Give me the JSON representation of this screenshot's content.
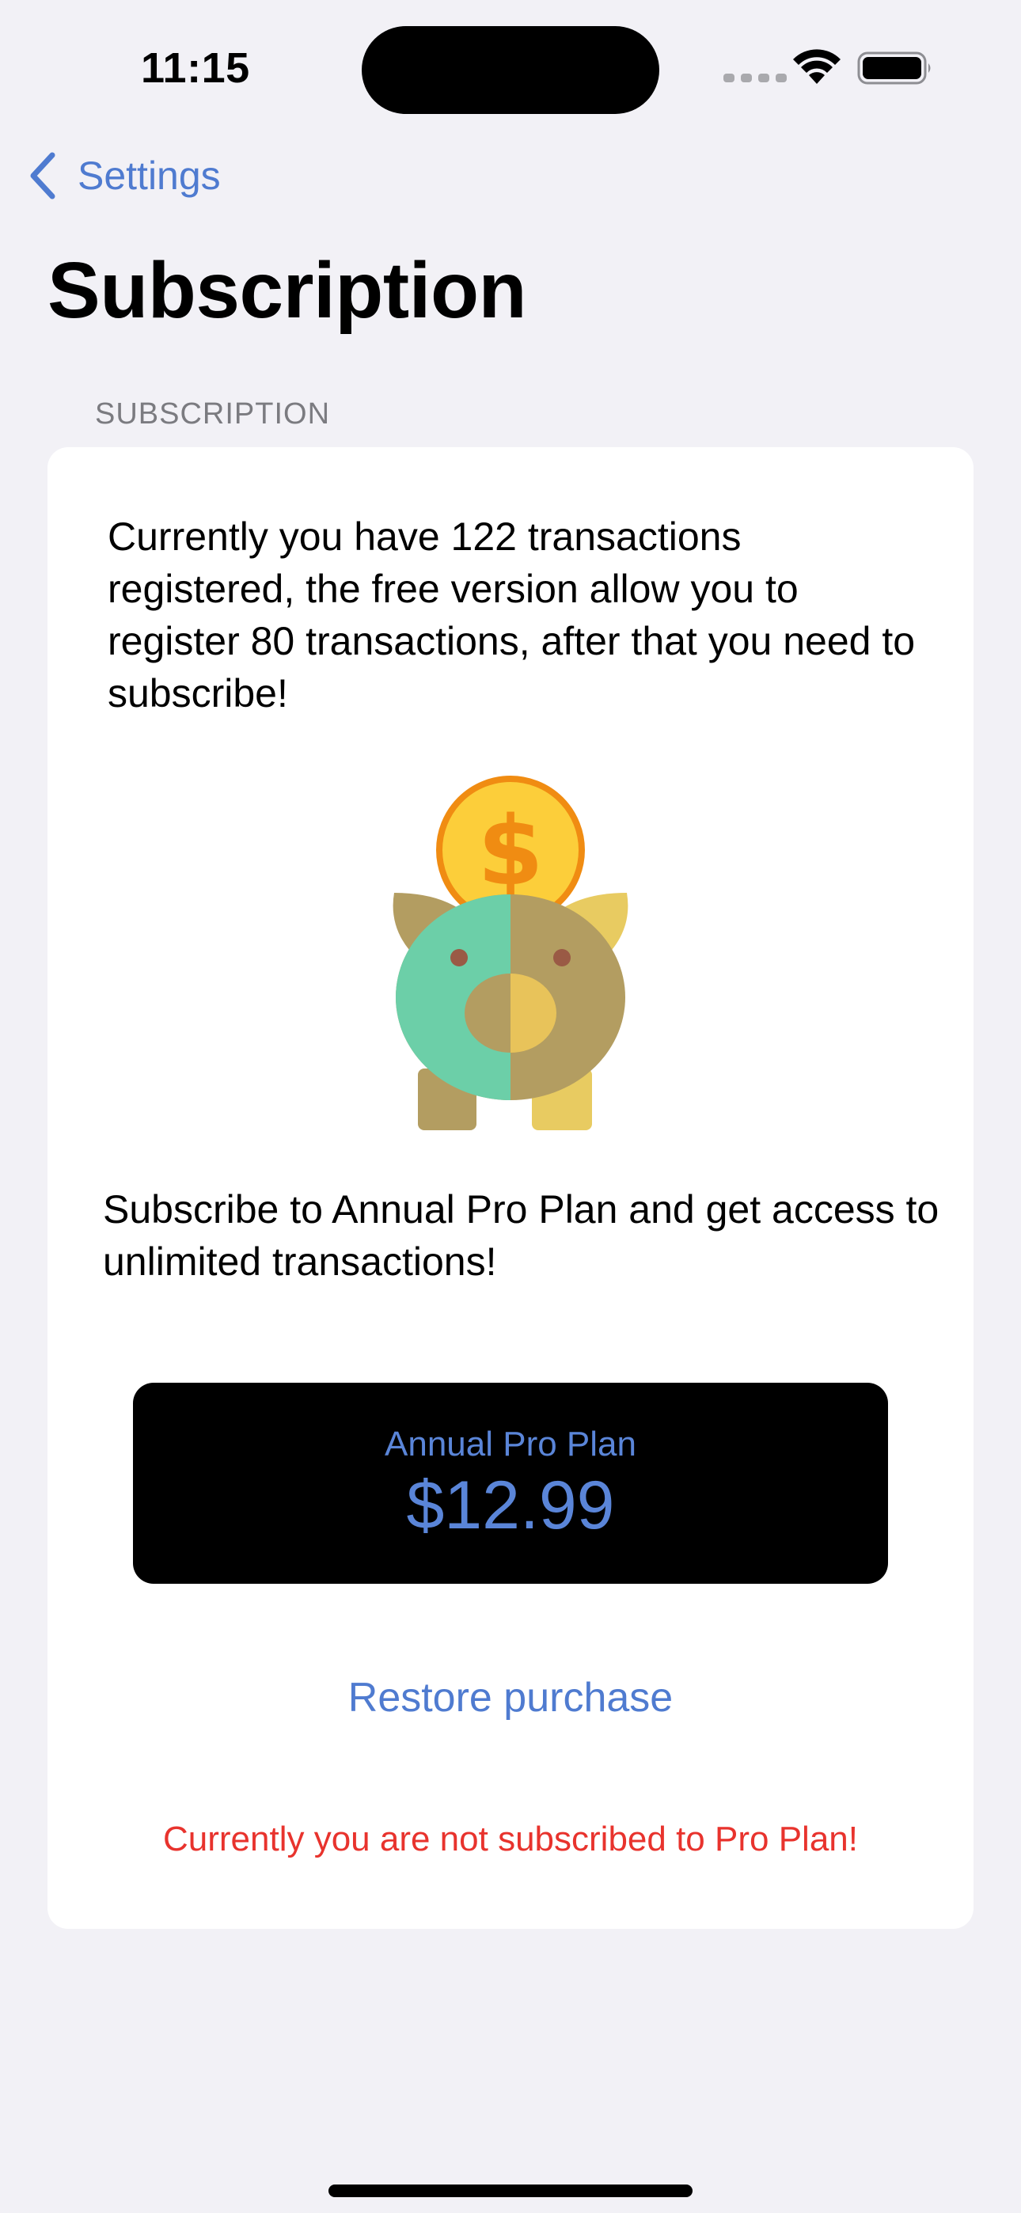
{
  "status_bar": {
    "time": "11:15"
  },
  "nav": {
    "back_label": "Settings",
    "title": "Subscription"
  },
  "section": {
    "header": "SUBSCRIPTION"
  },
  "card": {
    "info_text": "Currently you have 122 transactions registered, the free version allow you to register 80 transactions, after that you need to subscribe!",
    "promo_text": "Subscribe to Annual Pro Plan and get access to unlimited transactions!",
    "plan_button": {
      "name": "Annual Pro Plan",
      "price": "$12.99"
    },
    "restore_label": "Restore purchase",
    "status_message": "Currently you are not subscribed to Pro Plan!"
  },
  "icons": {
    "back": "chevron-left-icon",
    "illustration": "piggy-bank-coin-icon",
    "wifi": "wifi-icon",
    "battery": "battery-icon"
  },
  "colors": {
    "accent": "#4f7bd0",
    "button_text": "#5a85d8",
    "error": "#e8332d",
    "background": "#f2f1f6",
    "card": "#ffffff"
  }
}
